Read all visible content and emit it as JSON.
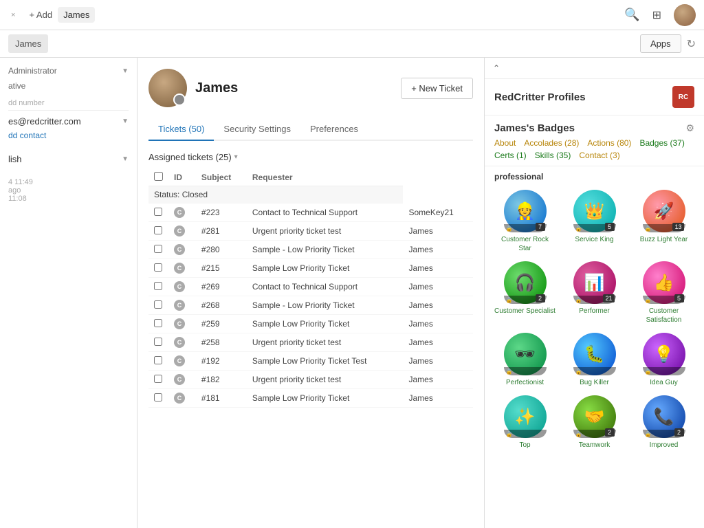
{
  "topbar": {
    "tab_close": "×",
    "add_label": "+ Add",
    "tab_label": "James",
    "apps_label": "Apps",
    "refresh_icon": "↻"
  },
  "subbars": {
    "label": "James"
  },
  "profile": {
    "name": "James",
    "new_ticket": "+ New Ticket"
  },
  "tabs": [
    {
      "id": "tickets",
      "label": "Tickets (50)",
      "active": true
    },
    {
      "id": "security",
      "label": "Security Settings",
      "active": false
    },
    {
      "id": "preferences",
      "label": "Preferences",
      "active": false
    }
  ],
  "tickets_section": {
    "assigned_label": "Assigned tickets (25)",
    "columns": [
      "",
      "ID",
      "Subject",
      "Requester"
    ],
    "status_group": "Status: Closed",
    "tickets": [
      {
        "id": "#223",
        "subject": "Contact to Technical Support",
        "requester": "SomeKey21"
      },
      {
        "id": "#281",
        "subject": "Urgent priority ticket test",
        "requester": "James"
      },
      {
        "id": "#280",
        "subject": "Sample - Low Priority Ticket",
        "requester": "James"
      },
      {
        "id": "#215",
        "subject": "Sample Low Priority Ticket",
        "requester": "James"
      },
      {
        "id": "#269",
        "subject": "Contact to Technical Support",
        "requester": "James"
      },
      {
        "id": "#268",
        "subject": "Sample - Low Priority Ticket",
        "requester": "James"
      },
      {
        "id": "#259",
        "subject": "Sample Low Priority Ticket",
        "requester": "James"
      },
      {
        "id": "#258",
        "subject": "Urgent priority ticket test",
        "requester": "James"
      },
      {
        "id": "#192",
        "subject": "Sample Low Priority Ticket Test",
        "requester": "James"
      },
      {
        "id": "#182",
        "subject": "Urgent priority ticket test",
        "requester": "James"
      },
      {
        "id": "#181",
        "subject": "Sample Low Priority Ticket",
        "requester": "James"
      }
    ]
  },
  "redcritter": {
    "panel_title": "RedCritter Profiles",
    "badges_title": "James's Badges",
    "links": [
      {
        "label": "About",
        "color": "yellow"
      },
      {
        "label": "Accolades (28)",
        "color": "yellow"
      },
      {
        "label": "Actions (80)",
        "color": "yellow"
      },
      {
        "label": "Badges (37)",
        "color": "green"
      },
      {
        "label": "Certs (1)",
        "color": "green"
      },
      {
        "label": "Skills (35)",
        "color": "green"
      },
      {
        "label": "Contact (3)",
        "color": "yellow"
      }
    ],
    "section_label": "professional",
    "badges": [
      {
        "id": "customer-rockstar",
        "name": "Customer Rock Star",
        "count": "7",
        "class": "badge-customer-rockstar"
      },
      {
        "id": "service-king",
        "name": "Service King",
        "count": "5",
        "class": "badge-service-king"
      },
      {
        "id": "buzz-lightyear",
        "name": "Buzz Light Year",
        "count": "13",
        "class": "badge-buzz-lightyear"
      },
      {
        "id": "customer-specialist",
        "name": "Customer Specialist",
        "count": "2",
        "class": "badge-customer-specialist"
      },
      {
        "id": "performer",
        "name": "Performer",
        "count": "21",
        "class": "badge-performer"
      },
      {
        "id": "customer-satisfaction",
        "name": "Customer Satisfaction",
        "count": "5",
        "class": "badge-customer-satisfaction"
      },
      {
        "id": "perfectionist",
        "name": "Perfectionist",
        "count": "",
        "class": "badge-perfectionist"
      },
      {
        "id": "bug-killer",
        "name": "Bug Killer",
        "count": "",
        "class": "badge-bug-killer"
      },
      {
        "id": "idea-guy",
        "name": "Idea Guy",
        "count": "",
        "class": "badge-idea-guy"
      },
      {
        "id": "top",
        "name": "Top",
        "count": "",
        "class": "badge-top"
      },
      {
        "id": "teamwork",
        "name": "Teamwork",
        "count": "2",
        "class": "badge-teamwork"
      },
      {
        "id": "improved",
        "name": "Improved",
        "count": "2",
        "class": "badge-improved"
      }
    ]
  }
}
